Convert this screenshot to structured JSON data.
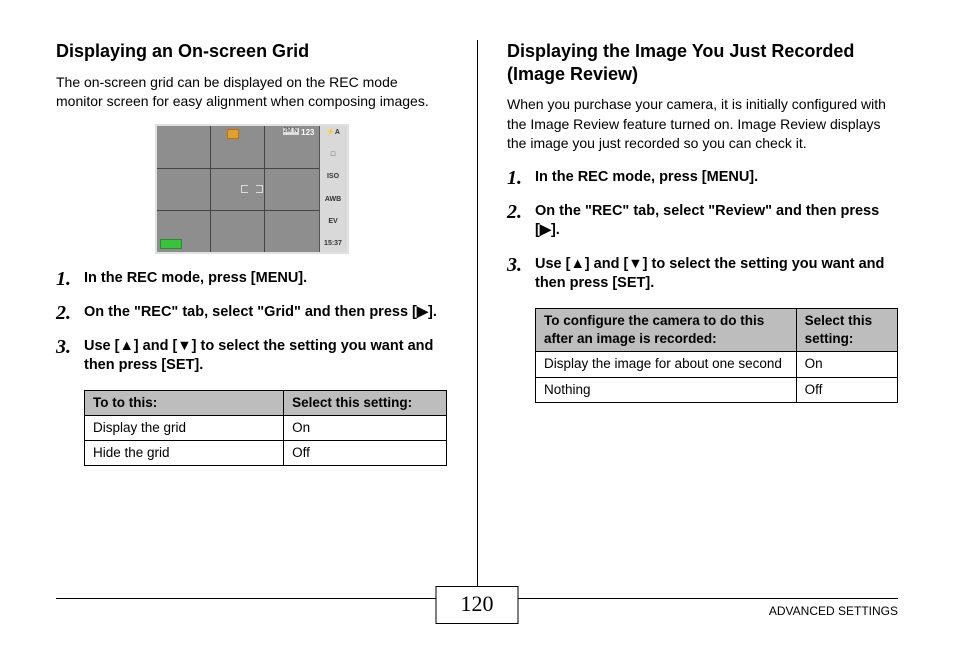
{
  "left": {
    "heading": "Displaying an On-screen Grid",
    "intro": "The on-screen grid can be displayed on the REC mode monitor screen for easy alignment when composing images.",
    "shot_icons": [
      "⚡A",
      "□",
      "ISO",
      "AWB",
      "EV",
      "15:37"
    ],
    "shot_count": "123",
    "shot_box": "2M N",
    "steps": [
      "In the REC mode, press [MENU].",
      "On the \"REC\" tab, select \"Grid\" and then press [▶].",
      "Use [▲] and [▼] to select the setting you want and then press [SET]."
    ],
    "table_head": [
      "To to this:",
      "Select this setting:"
    ],
    "table_rows": [
      [
        "Display the grid",
        "On"
      ],
      [
        "Hide the grid",
        "Off"
      ]
    ]
  },
  "right": {
    "heading": "Displaying the Image You Just Recorded (Image Review)",
    "intro": "When you purchase your camera, it is initially configured with the Image Review feature turned on. Image Review displays the image you just recorded so you can check it.",
    "steps": [
      "In the REC mode, press [MENU].",
      "On the \"REC\" tab, select \"Review\" and then press [▶].",
      "Use [▲] and [▼] to select the setting you want and then press [SET]."
    ],
    "table_head": [
      "To configure the camera to do this after an image is recorded:",
      "Select this setting:"
    ],
    "table_rows": [
      [
        "Display the image for about one second",
        "On"
      ],
      [
        "Nothing",
        "Off"
      ]
    ]
  },
  "page_number": "120",
  "section_label": "ADVANCED SETTINGS"
}
